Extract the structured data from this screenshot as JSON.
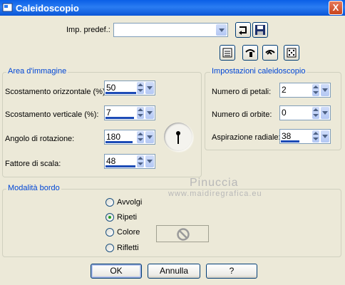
{
  "window": {
    "title": "Caleidoscopio",
    "close_label": "X"
  },
  "preset": {
    "label": "Imp. predef.:",
    "value": ""
  },
  "area": {
    "title": "Area d'immagine",
    "fields": [
      {
        "label": "Scostamento orizzontale (%):",
        "value": "50"
      },
      {
        "label": "Scostamento verticale (%):",
        "value": "7"
      },
      {
        "label": "Angolo di rotazione:",
        "value": "180"
      },
      {
        "label": "Fattore di scala:",
        "value": "48"
      }
    ]
  },
  "settings": {
    "title": "Impostazioni caleidoscopio",
    "fields": [
      {
        "label": "Numero di petali:",
        "value": "2"
      },
      {
        "label": "Numero di orbite:",
        "value": "0"
      },
      {
        "label": "Aspirazione radiale:",
        "value": "38"
      }
    ]
  },
  "border_mode": {
    "title": "Modalità bordo",
    "options": [
      "Avvolgi",
      "Ripeti",
      "Colore",
      "Rifletti"
    ],
    "selected": "Ripeti"
  },
  "buttons": {
    "ok": "OK",
    "cancel": "Annulla",
    "help": "?"
  },
  "watermark": {
    "name": "Pinuccia",
    "site": "www.maidiregrafica.eu"
  },
  "icons": [
    "dialog-icon",
    "reset-icon",
    "save-preset-icon",
    "preview-icon",
    "zoom-icon",
    "undo-icon",
    "random-icon",
    "rotation-dial-icon",
    "color-no-icon"
  ]
}
